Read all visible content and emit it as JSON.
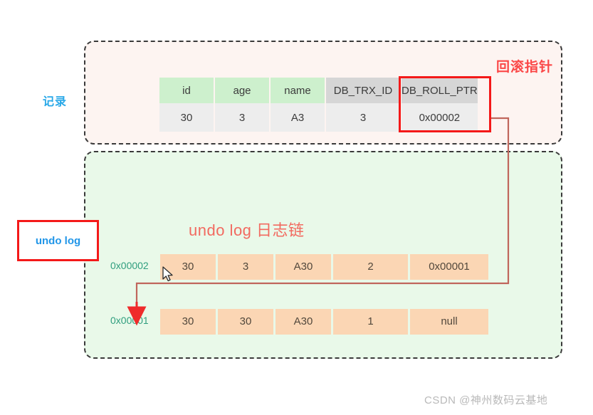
{
  "diagram": {
    "record_panel": {
      "side_label": "记录",
      "annotation_label": "回滚指针",
      "columns": [
        "id",
        "age",
        "name",
        "DB_TRX_ID",
        "DB_ROLL_PTR"
      ],
      "row": [
        "30",
        "3",
        "A3",
        "3",
        "0x00002"
      ],
      "highlighted_column": "DB_ROLL_PTR"
    },
    "undo_panel": {
      "side_label": "undo log",
      "title": "undo log 日志链",
      "rows": [
        {
          "pointer": "0x00002",
          "cells": [
            "30",
            "3",
            "A30",
            "2",
            "0x00001"
          ]
        },
        {
          "pointer": "0x00001",
          "cells": [
            "30",
            "30",
            "A30",
            "1",
            "null"
          ]
        }
      ]
    },
    "watermark": "CSDN @神州数码云基地",
    "colors": {
      "record_panel_bg": "#fdf4f1",
      "undo_panel_bg": "#e9f9e9",
      "header_green": "#cdf0cd",
      "header_gray": "#d6d6d6",
      "cell_gray": "#ededed",
      "undo_cell": "#fbd6b4",
      "highlight_red": "#f41919",
      "annotation_red": "#fb4848",
      "title_red": "#f26a60",
      "side_label_blue": "#28a8e8",
      "pointer_teal": "#2f9e7e",
      "connector": "#c0665c"
    }
  }
}
